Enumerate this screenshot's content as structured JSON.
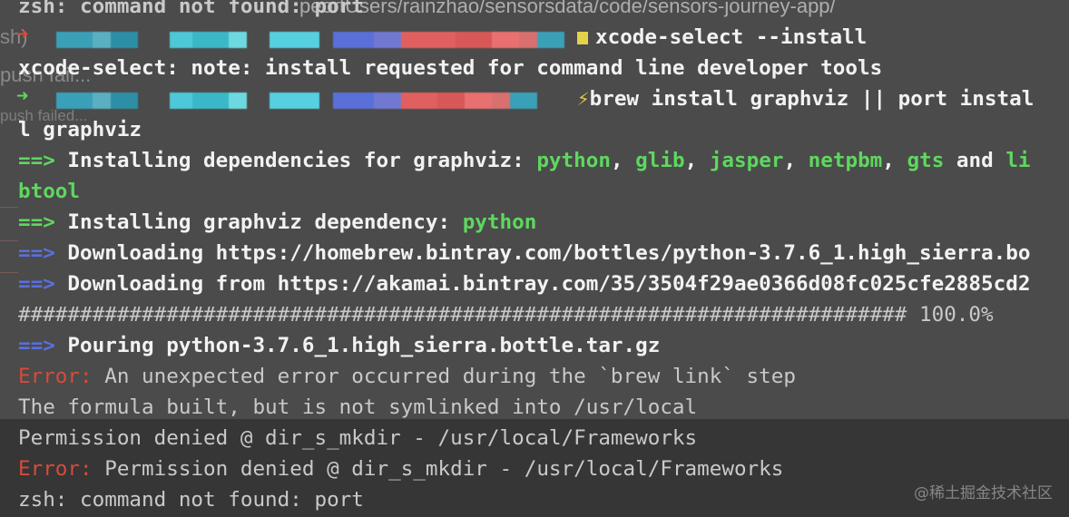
{
  "ghost": {
    "path": "peortUsers/rainzhao/sensorsdata/code/sensors-journey-app/",
    "sh": "sh)",
    "push1": "push fail...",
    "push2": "push failed..."
  },
  "terminal": {
    "l1": "zsh: command not found: port",
    "l2_cmd": "xcode-select --install",
    "l3": "xcode-select: note: install requested for command line developer tools",
    "l4_cmd": "brew install graphviz || port instal",
    "l5": "l graphviz",
    "l6_prefix": "==>",
    "l6_text": " Installing dependencies for graphviz: ",
    "l6_dep1": "python",
    "l6_sep1": ", ",
    "l6_dep2": "glib",
    "l6_sep2": ", ",
    "l6_dep3": "jasper",
    "l6_sep3": ", ",
    "l6_dep4": "netpbm",
    "l6_sep4": ", ",
    "l6_dep5": "gts",
    "l6_and": " and ",
    "l6_dep6a": "li",
    "l7_dep6b": "btool",
    "l8_prefix": "==>",
    "l8_text": " Installing graphviz dependency: ",
    "l8_dep": "python",
    "l9_prefix": "==>",
    "l9_text": " Downloading https://homebrew.bintray.com/bottles/python-3.7.6_1.high_sierra.bo",
    "l10_prefix": "==>",
    "l10_text": " Downloading from https://akamai.bintray.com/35/3504f29ae0366d08fc025cfe2885cd2",
    "l11_bar": "######################################################################## 100.0%",
    "l12_prefix": "==>",
    "l12_text": " Pouring python-3.7.6_1.high_sierra.bottle.tar.gz",
    "l13_err": "Error:",
    "l13_text": " An unexpected error occurred during the `brew link` step",
    "l14": "The formula built, but is not symlinked into /usr/local",
    "l15": "Permission denied @ dir_s_mkdir - /usr/local/Frameworks",
    "l16_err": "Error:",
    "l16_text": " Permission denied @ dir_s_mkdir - /usr/local/Frameworks",
    "l17": "zsh: command not found: port"
  },
  "watermark": "@稀土掘金技术社区",
  "colors": {
    "green": "#5fd75f",
    "blue": "#5a6fe0",
    "red": "#d64b3c",
    "yellow": "#e3c94a",
    "text": "#d8d8d8"
  }
}
